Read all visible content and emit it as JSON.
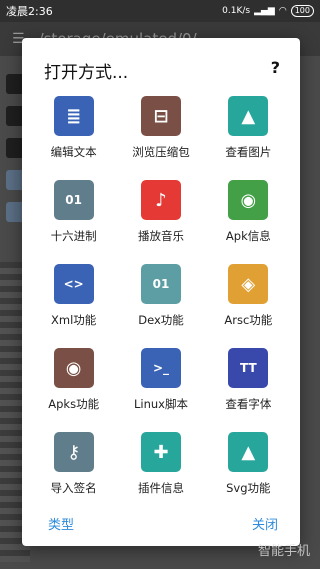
{
  "status_bar": {
    "time": "凌晨2:36",
    "speed": "0.1K/s",
    "battery": "100"
  },
  "background_app": {
    "path": "/storage/emulated/0/",
    "menu_icon": "hamburger-icon"
  },
  "dialog": {
    "title": "打开方式...",
    "help_label": "?",
    "items": [
      {
        "label": "编辑文本",
        "icon": "document-icon",
        "color": "#3a63b6",
        "glyph": "≣"
      },
      {
        "label": "浏览压缩包",
        "icon": "archive-icon",
        "color": "#7a5046",
        "glyph": "⊟"
      },
      {
        "label": "查看图片",
        "icon": "image-icon",
        "color": "#27a69b",
        "glyph": "▲"
      },
      {
        "label": "十六进制",
        "icon": "binary-file-icon",
        "color": "#607d8b",
        "glyph": "01"
      },
      {
        "label": "播放音乐",
        "icon": "music-note-icon",
        "color": "#e53935",
        "glyph": "♪"
      },
      {
        "label": "Apk信息",
        "icon": "android-icon",
        "color": "#43a047",
        "glyph": "◉"
      },
      {
        "label": "Xml功能",
        "icon": "code-file-icon",
        "color": "#3a63b6",
        "glyph": "<>"
      },
      {
        "label": "Dex功能",
        "icon": "binary-file-icon",
        "color": "#5c9ea3",
        "glyph": "01"
      },
      {
        "label": "Arsc功能",
        "icon": "layers-icon",
        "color": "#e0a033",
        "glyph": "◈"
      },
      {
        "label": "Apks功能",
        "icon": "android-icon",
        "color": "#7a5046",
        "glyph": "◉"
      },
      {
        "label": "Linux脚本",
        "icon": "terminal-icon",
        "color": "#3a63b6",
        "glyph": ">_"
      },
      {
        "label": "查看字体",
        "icon": "font-icon",
        "color": "#3949ab",
        "glyph": "TT"
      },
      {
        "label": "导入签名",
        "icon": "key-icon",
        "color": "#607d8b",
        "glyph": "⚷"
      },
      {
        "label": "插件信息",
        "icon": "puzzle-icon",
        "color": "#27a69b",
        "glyph": "✚"
      },
      {
        "label": "Svg功能",
        "icon": "image-icon",
        "color": "#27a69b",
        "glyph": "▲"
      }
    ],
    "footer": {
      "type_label": "类型",
      "close_label": "关闭"
    }
  },
  "watermark": "智能手机"
}
